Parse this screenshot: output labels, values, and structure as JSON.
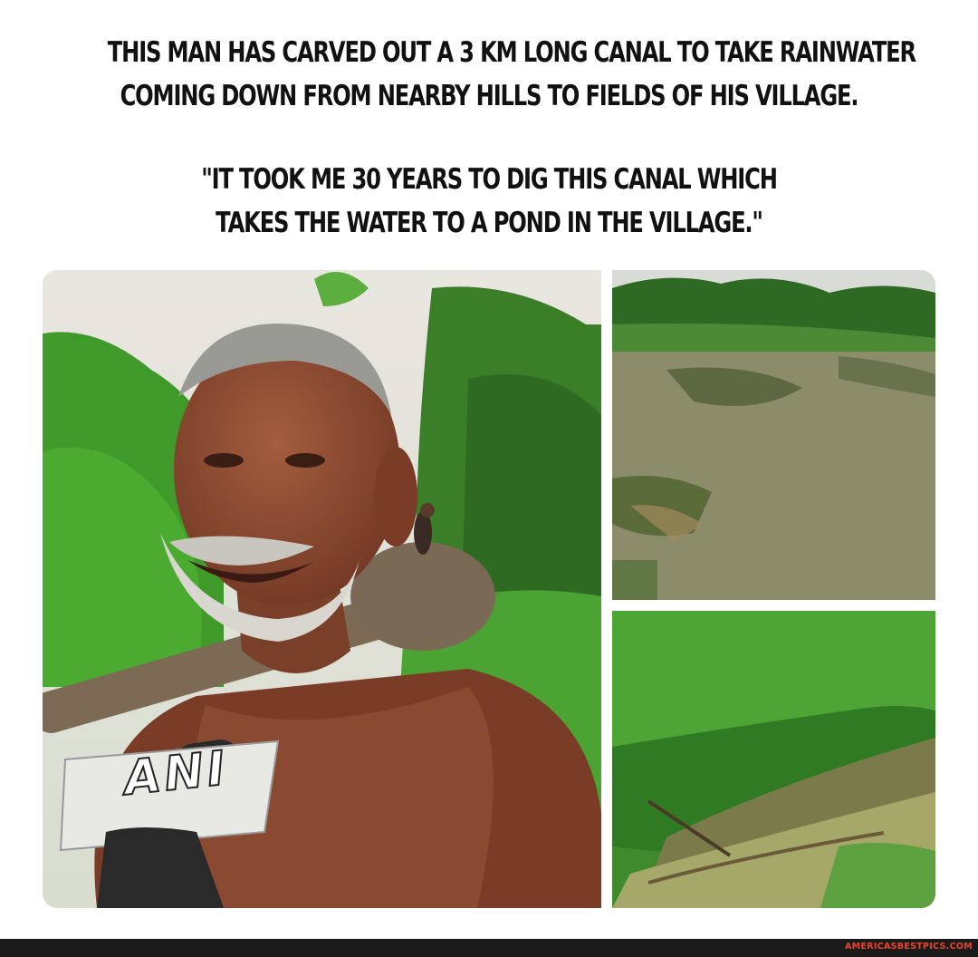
{
  "caption": {
    "line1": "THIS MAN HAS CARVED OUT A 3 KM LONG CANAL TO TAKE RAINWATER",
    "line2": "COMING DOWN FROM NEARBY HILLS TO FIELDS OF HIS VILLAGE.",
    "quote_line1": "\"IT TOOK ME 30 YEARS TO DIG THIS CANAL WHICH",
    "quote_line2": "TAKES THE WATER TO A POND IN THE VILLAGE.\""
  },
  "photos": {
    "man": {
      "microphone_label": "ANI"
    },
    "pond": {},
    "canal": {}
  },
  "footer": {
    "watermark": "AMERICASBESTPICS.COM"
  },
  "colors": {
    "text": "#111111",
    "footer_bg": "#1a1a1a",
    "watermark": "#e8452c",
    "foliage": "#3f9a2a",
    "skin": "#8a4a32",
    "pond_water": "#8a8c6a"
  }
}
